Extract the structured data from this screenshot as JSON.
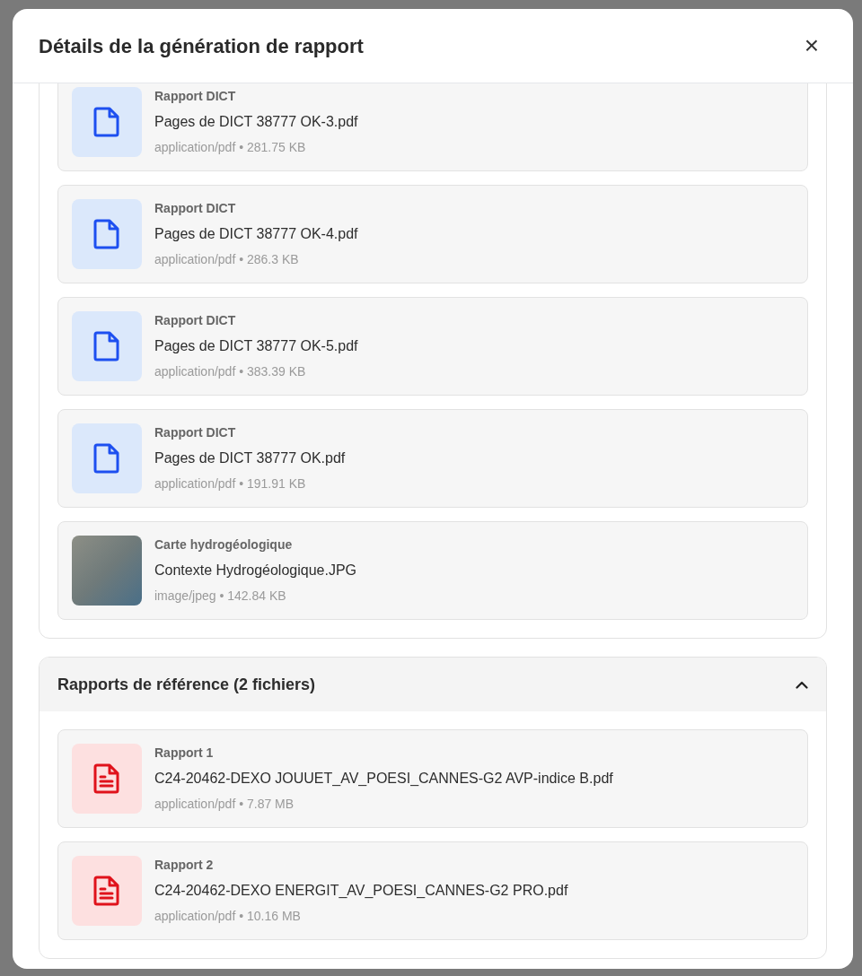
{
  "modal": {
    "title": "Détails de la génération de rapport",
    "close": "×"
  },
  "sections": [
    {
      "files": [
        {
          "kind": "file",
          "category": "Rapport DICT",
          "name": "Pages de DICT 38777 OK-3.pdf",
          "details": "application/pdf • 281.75 KB"
        },
        {
          "kind": "file",
          "category": "Rapport DICT",
          "name": "Pages de DICT 38777 OK-4.pdf",
          "details": "application/pdf • 286.3 KB"
        },
        {
          "kind": "file",
          "category": "Rapport DICT",
          "name": "Pages de DICT 38777 OK-5.pdf",
          "details": "application/pdf • 383.39 KB"
        },
        {
          "kind": "file",
          "category": "Rapport DICT",
          "name": "Pages de DICT 38777 OK.pdf",
          "details": "application/pdf • 191.91 KB"
        },
        {
          "kind": "photo",
          "category": "Carte hydrogéologique",
          "name": "Contexte Hydrogéologique.JPG",
          "details": "image/jpeg • 142.84 KB"
        }
      ]
    },
    {
      "header": "Rapports de référence (2 fichiers)",
      "expanded": true,
      "files": [
        {
          "kind": "report",
          "category": "Rapport 1",
          "name": "C24-20462-DEXO JOUUET_AV_POESI_CANNES-G2 AVP-indice B.pdf",
          "details": "application/pdf • 7.87 MB"
        },
        {
          "kind": "report",
          "category": "Rapport 2",
          "name": "C24-20462-DEXO ENERGIT_AV_POESI_CANNES-G2 PRO.pdf",
          "details": "application/pdf • 10.16 MB"
        }
      ]
    }
  ]
}
